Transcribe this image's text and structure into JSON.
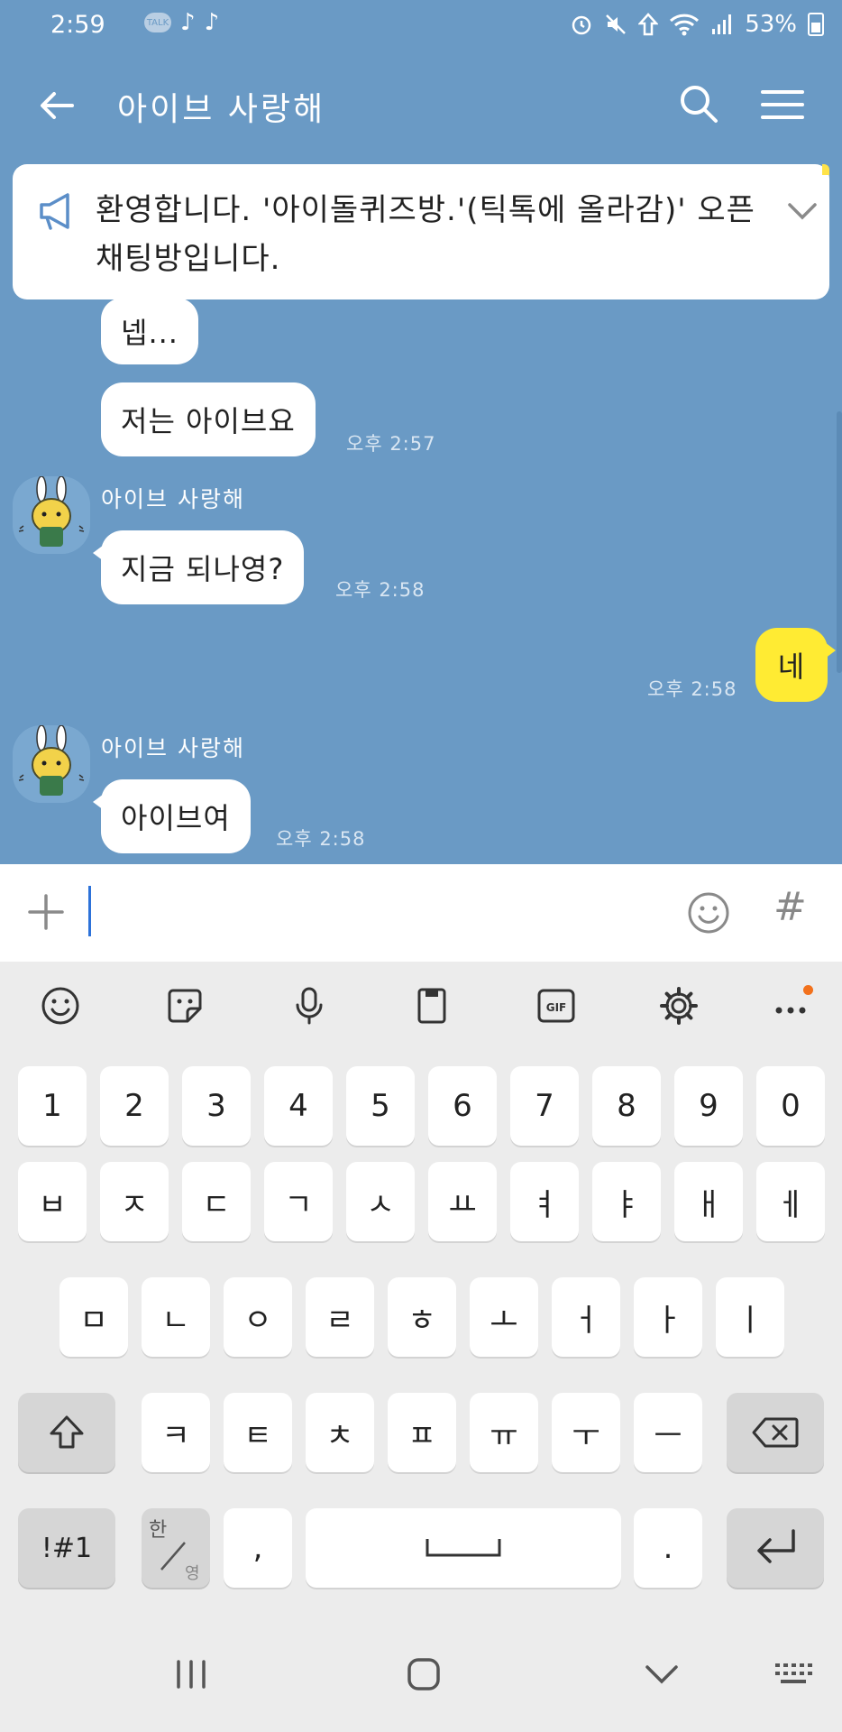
{
  "status_bar": {
    "time": "2:59",
    "notification_icons": [
      "talk-badge-icon",
      "tiktok-icon",
      "tiktok-icon"
    ],
    "battery": "53%",
    "right_icons": [
      "alarm-icon",
      "mute-icon",
      "data-saver-icon",
      "wifi-icon",
      "signal-icon",
      "battery-icon"
    ]
  },
  "header": {
    "title": "아이브 사랑해",
    "back_icon": "back-arrow-icon",
    "search_icon": "search-icon",
    "menu_icon": "menu-icon"
  },
  "notice": {
    "text": "환영합니다. '아이돌퀴즈방.'(틱톡에 올라감)' 오픈채팅방입니다.",
    "icon": "megaphone-icon"
  },
  "messages": [
    {
      "type": "received",
      "text": "넵...",
      "timestamp": ""
    },
    {
      "type": "received",
      "text": "저는 아이브요",
      "timestamp": "오후 2:57"
    },
    {
      "type": "received",
      "sender": "아이브 사랑해",
      "text": "지금 되나영?",
      "timestamp": "오후 2:58"
    },
    {
      "type": "sent",
      "text": "네",
      "timestamp": "오후 2:58"
    },
    {
      "type": "received",
      "sender": "아이브 사랑해",
      "text": "아이브여",
      "timestamp": "오후 2:58"
    }
  ],
  "input": {
    "value": "",
    "plus_icon": "plus-icon",
    "emoji_icon": "emoji-icon",
    "hash_label": "#"
  },
  "keyboard": {
    "toolbar": [
      "emoji-icon",
      "sticker-icon",
      "microphone-icon",
      "clipboard-icon",
      "gif-icon",
      "gear-icon",
      "more-icon"
    ],
    "row1": [
      "1",
      "2",
      "3",
      "4",
      "5",
      "6",
      "7",
      "8",
      "9",
      "0"
    ],
    "row2": [
      "ㅂ",
      "ㅈ",
      "ㄷ",
      "ㄱ",
      "ㅅ",
      "ㅛ",
      "ㅕ",
      "ㅑ",
      "ㅐ",
      "ㅔ"
    ],
    "row3": [
      "ㅁ",
      "ㄴ",
      "ㅇ",
      "ㄹ",
      "ㅎ",
      "ㅗ",
      "ㅓ",
      "ㅏ",
      "ㅣ"
    ],
    "row4": [
      "ㅋ",
      "ㅌ",
      "ㅊ",
      "ㅍ",
      "ㅠ",
      "ㅜ",
      "ㅡ"
    ],
    "symbols_label": "!#1",
    "lang_top": "한",
    "lang_bottom": "영",
    "comma_label": ",",
    "period_label": "."
  },
  "colors": {
    "chat_background": "#6a9ac5",
    "sent_bubble": "#ffeb33",
    "received_bubble": "#ffffff",
    "cursor": "#2d72d9"
  }
}
